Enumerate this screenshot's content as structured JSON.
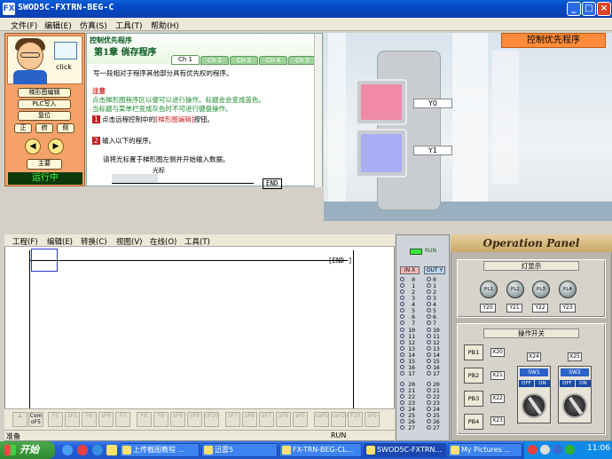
{
  "window": {
    "title": "SWOD5C-FXTRN-BEG-C",
    "logo": "FX"
  },
  "menu": [
    "文件(F)",
    "编辑(E)",
    "仿真(S)",
    "工具(T)",
    "帮助(H)"
  ],
  "left_panel": {
    "click_label": "click",
    "buttons": [
      "梯形图编辑",
      "PLC写入",
      "复位"
    ],
    "view_buttons": [
      "正",
      "俯",
      "侧"
    ],
    "main_button": "主要",
    "status": "运行中"
  },
  "lesson": {
    "category": "控制优先程序",
    "chapter": "第1章",
    "title": "倘存程序",
    "tabs": [
      "Ch 1",
      "Ch 2",
      "Ch 3",
      "Ch 4",
      "Ch 5"
    ],
    "intro": "写一段相对于程序其他部分具有优先权的程序。",
    "note_title": "注意",
    "note_line1": "点击梯形图程序区以便可以进行操作。标题会会变成蓝色。",
    "note_line2": "当标题与菜单栏变成灰色时不可进行键盘操作。",
    "step1_pre": "点击远程控制中的",
    "step1_link": "[梯形图编辑]",
    "step1_post": "按钮。",
    "step2": "输入以下的程序。",
    "hint": "请将光标置于梯形图左侧并开始输入数据。",
    "cursor_label": "光标",
    "end_label": "END"
  },
  "simulation": {
    "control_label": "控制优先程序",
    "lamp_labels": [
      "Y0",
      "Y1"
    ]
  },
  "ladder": {
    "menu": [
      "工程(F)",
      "编辑(E)",
      "转换(C)",
      "视图(V)",
      "在线(O)",
      "工具(T)"
    ],
    "end_label": "END",
    "status_left": "准备",
    "status_mid": "RUN",
    "ftool_keys": [
      "F5",
      "sF5",
      "F6",
      "sF6",
      "F7",
      "F8",
      "F9",
      "sF9",
      "cF9",
      "cF10",
      "sF7",
      "sF8",
      "aF7",
      "aF8",
      "aF5",
      "caF5",
      "caF10",
      "F10",
      "aF9"
    ],
    "ftool_first": [
      "Com",
      "oF5"
    ]
  },
  "io": {
    "run": "RUN",
    "in_header": "IN X",
    "out_header": "OUT Y",
    "in_group1": [
      "0",
      "1",
      "2",
      "3",
      "4",
      "5",
      "6",
      "7"
    ],
    "in_group2": [
      "10",
      "11",
      "12",
      "13",
      "14",
      "15",
      "16",
      "17"
    ],
    "in_group3": [
      "20",
      "21",
      "22",
      "23",
      "24",
      "25",
      "26",
      "27"
    ]
  },
  "operation_panel": {
    "title": "Operation Panel",
    "lamp_section": "灯显示",
    "lamps": [
      "PL1",
      "PL2",
      "PL3",
      "PL4"
    ],
    "lamp_outputs": [
      "Y20",
      "Y21",
      "Y22",
      "Y23"
    ],
    "switch_section": "操作开关",
    "push_buttons": [
      {
        "label": "PB1",
        "x": "X20"
      },
      {
        "label": "PB2",
        "x": "X21"
      },
      {
        "label": "PB3",
        "x": "X22"
      },
      {
        "label": "PB4",
        "x": "X23"
      }
    ],
    "switches": [
      {
        "name": "SW1",
        "x": "X24",
        "off": "OFF",
        "on": "ON"
      },
      {
        "name": "SW2",
        "x": "X25",
        "off": "OFF",
        "on": "ON"
      }
    ]
  },
  "taskbar": {
    "start": "开始",
    "items": [
      "上传截图教程 ...",
      "迅雷5",
      "FX-TRN-BEG-CL...",
      "SWOD5C-FXTRN...",
      "My Pictures ..."
    ],
    "clock": "11:06"
  }
}
